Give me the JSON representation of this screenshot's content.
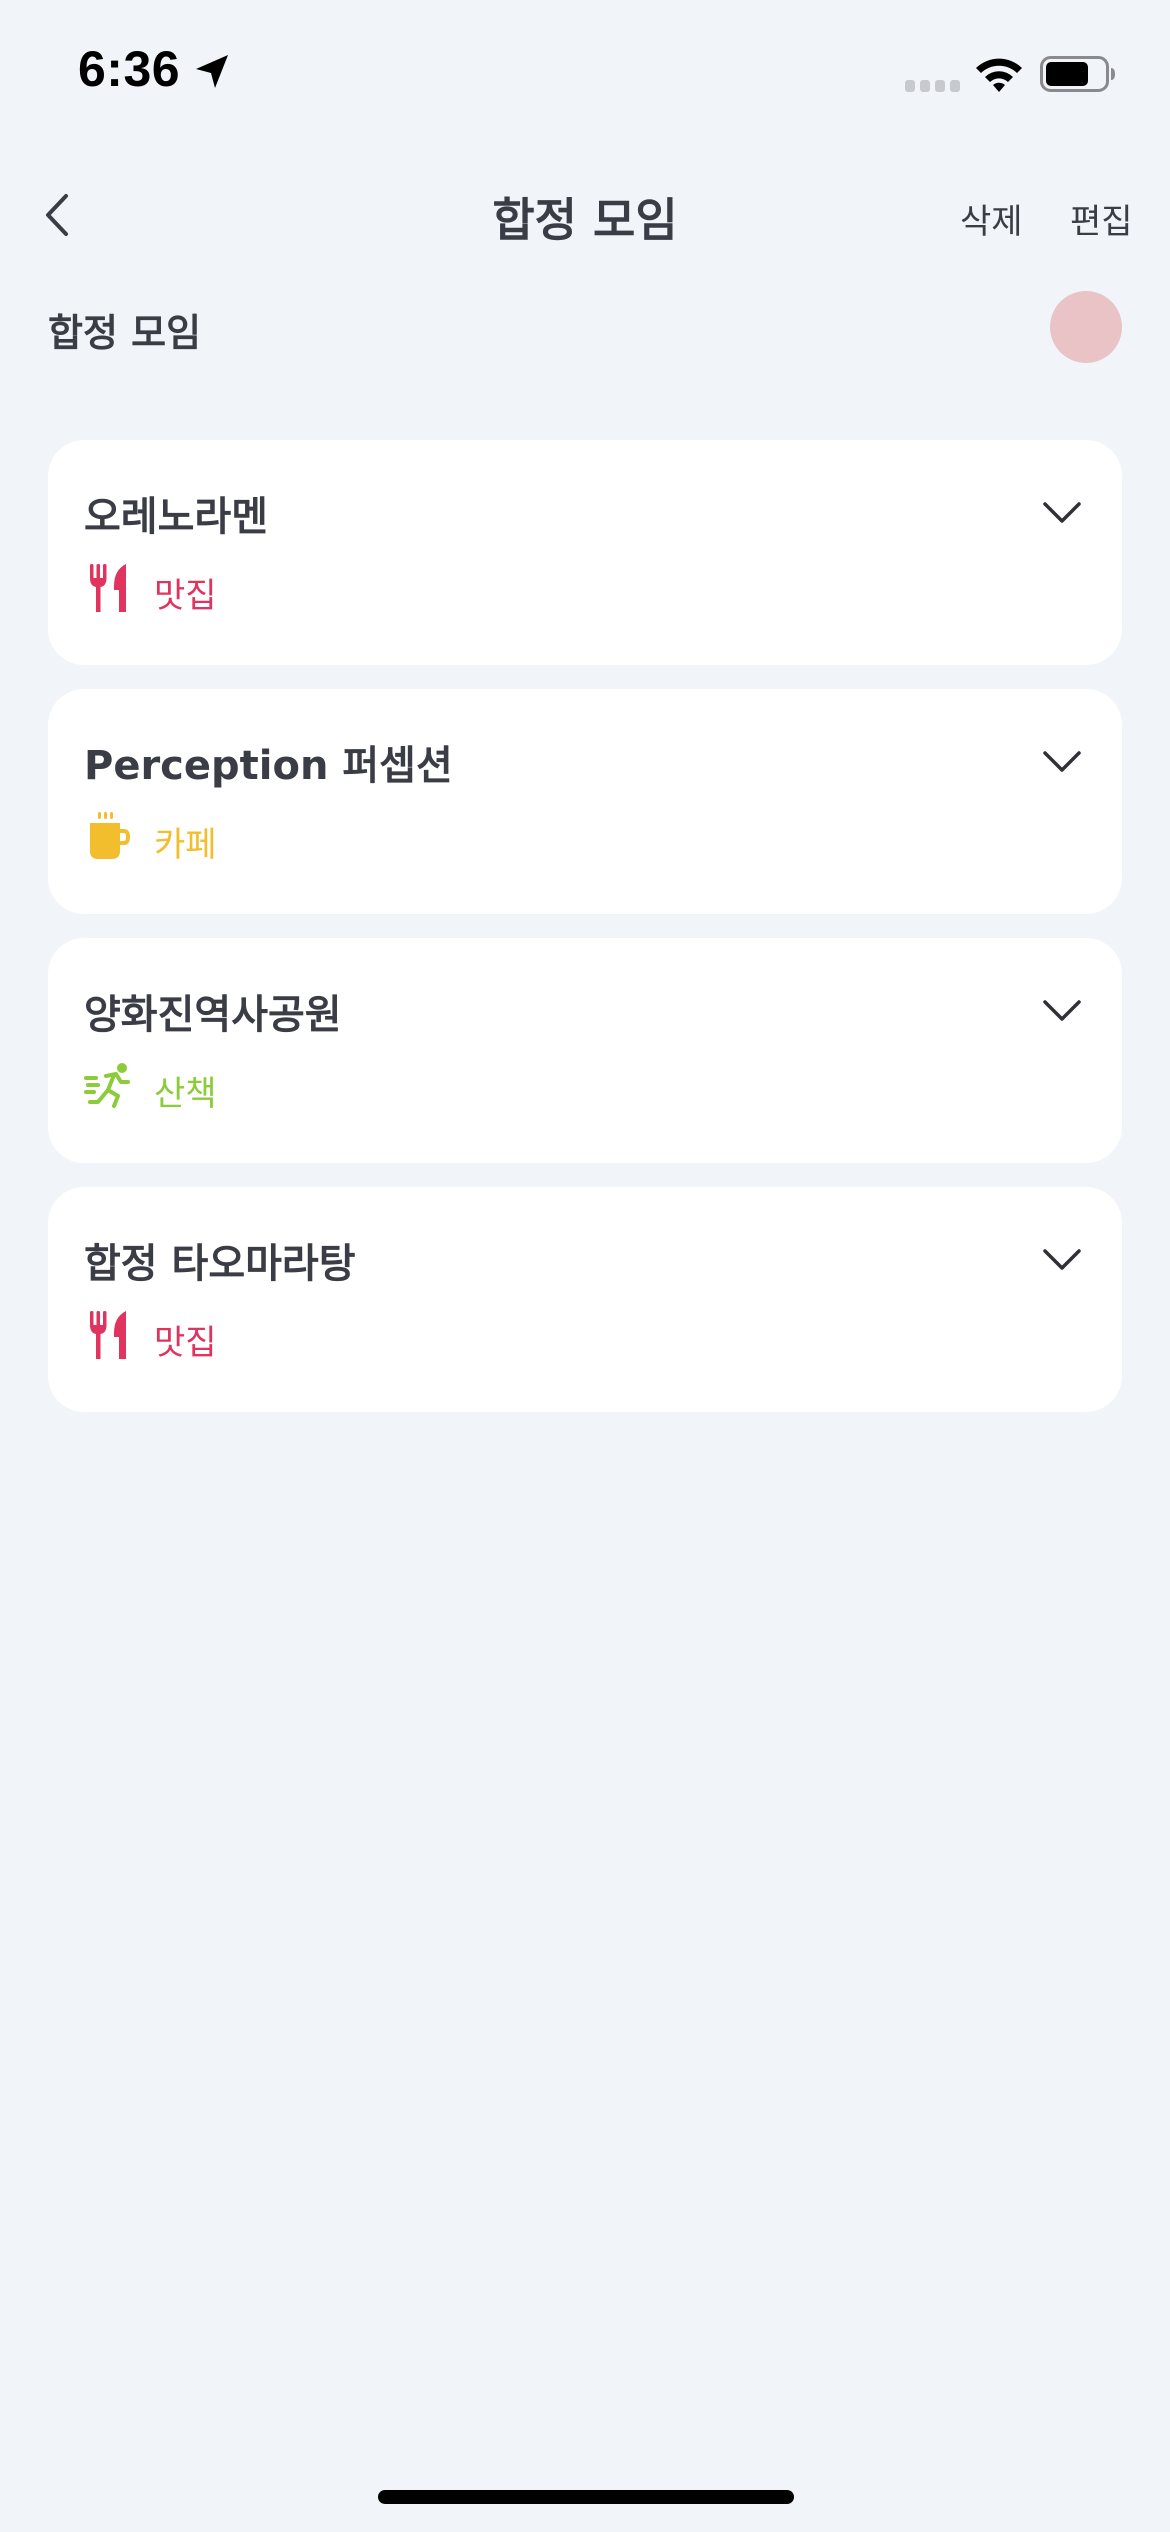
{
  "status_bar": {
    "time": "6:36",
    "icons": [
      "location-arrow-icon",
      "cellular-signal-icon",
      "wifi-icon",
      "battery-icon"
    ]
  },
  "nav": {
    "title": "합정 모임",
    "back_icon": "chevron-left-icon",
    "delete_label": "삭제",
    "edit_label": "편집"
  },
  "group": {
    "name": "합정 모임",
    "color": "#E9C3C6"
  },
  "places": [
    {
      "name": "오레노라멘",
      "category": "맛집",
      "category_icon": "fork-knife-icon",
      "color": "#E0345E"
    },
    {
      "name": "Perception 퍼셉션",
      "category": "카페",
      "category_icon": "coffee-cup-icon",
      "color": "#F3BE2D"
    },
    {
      "name": "양화진역사공원",
      "category": "산책",
      "category_icon": "running-person-icon",
      "color": "#8CCB3A"
    },
    {
      "name": "합정 타오마라탕",
      "category": "맛집",
      "category_icon": "fork-knife-icon",
      "color": "#E0345E"
    }
  ],
  "colors": {
    "background": "#F1F4F9",
    "card": "#FFFFFF",
    "text": "#3A3D45"
  }
}
